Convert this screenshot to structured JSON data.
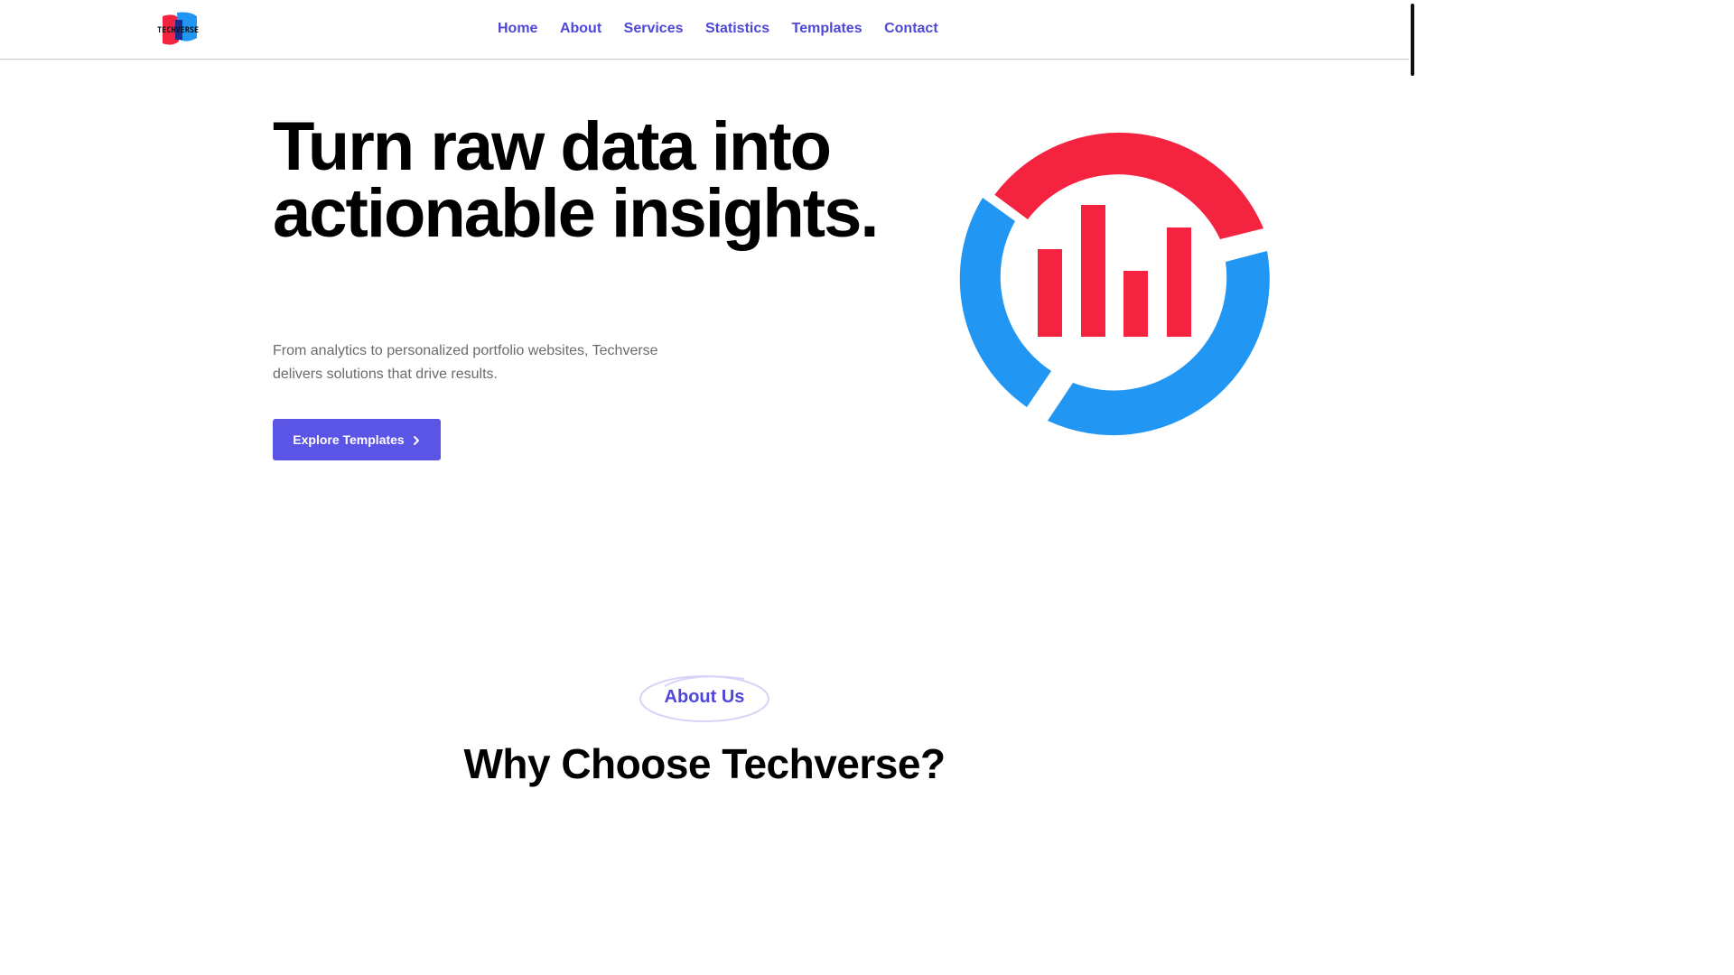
{
  "header": {
    "logo_text": "TECHVERSE",
    "nav": [
      {
        "label": "Home"
      },
      {
        "label": "About"
      },
      {
        "label": "Services"
      },
      {
        "label": "Statistics"
      },
      {
        "label": "Templates"
      },
      {
        "label": "Contact"
      }
    ]
  },
  "hero": {
    "title": "Turn raw data into actionable insights.",
    "subtitle": "From analytics to personalized portfolio websites, Techverse delivers solutions that drive results.",
    "cta_label": "Explore Templates",
    "cta_icon": "chevron-right-icon",
    "illustration": "analytics-chart-icon"
  },
  "about": {
    "badge_label": "About Us",
    "section_title": "Why Choose Techverse?"
  },
  "colors": {
    "accent": "#5b55e6",
    "nav_text": "#4f48d6",
    "red": "#f42441",
    "blue": "#2196f3"
  }
}
